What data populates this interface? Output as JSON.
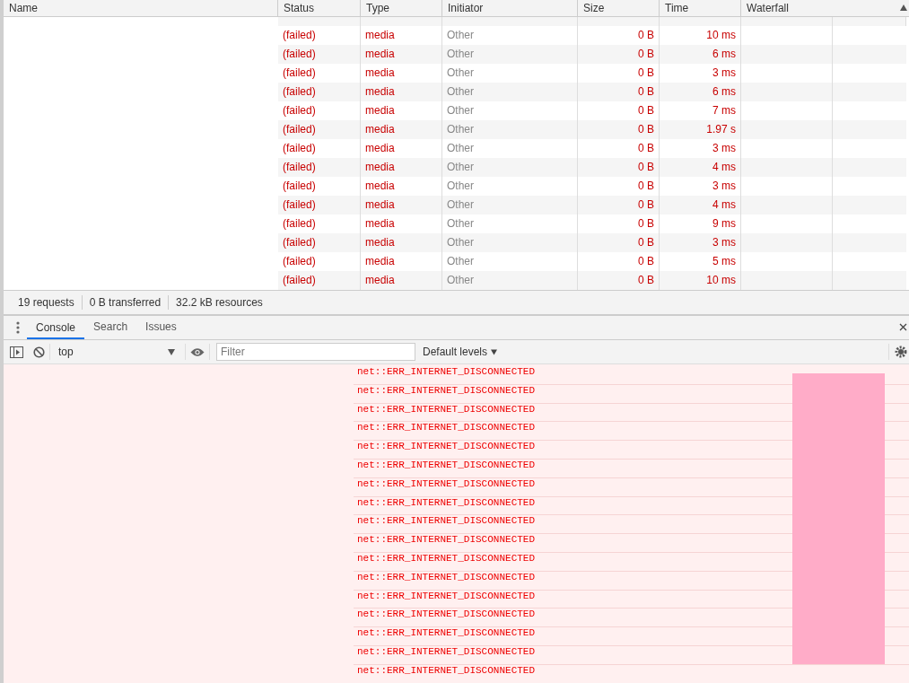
{
  "network": {
    "columns": [
      "Name",
      "Status",
      "Type",
      "Initiator",
      "Size",
      "Time",
      "Waterfall"
    ],
    "rows": [
      {
        "status": "(failed)",
        "type": "media",
        "initiator": "Other",
        "size": "0 B",
        "time": "10 ms"
      },
      {
        "status": "(failed)",
        "type": "media",
        "initiator": "Other",
        "size": "0 B",
        "time": "6 ms"
      },
      {
        "status": "(failed)",
        "type": "media",
        "initiator": "Other",
        "size": "0 B",
        "time": "3 ms"
      },
      {
        "status": "(failed)",
        "type": "media",
        "initiator": "Other",
        "size": "0 B",
        "time": "6 ms"
      },
      {
        "status": "(failed)",
        "type": "media",
        "initiator": "Other",
        "size": "0 B",
        "time": "7 ms"
      },
      {
        "status": "(failed)",
        "type": "media",
        "initiator": "Other",
        "size": "0 B",
        "time": "1.97 s"
      },
      {
        "status": "(failed)",
        "type": "media",
        "initiator": "Other",
        "size": "0 B",
        "time": "3 ms"
      },
      {
        "status": "(failed)",
        "type": "media",
        "initiator": "Other",
        "size": "0 B",
        "time": "4 ms"
      },
      {
        "status": "(failed)",
        "type": "media",
        "initiator": "Other",
        "size": "0 B",
        "time": "3 ms"
      },
      {
        "status": "(failed)",
        "type": "media",
        "initiator": "Other",
        "size": "0 B",
        "time": "4 ms"
      },
      {
        "status": "(failed)",
        "type": "media",
        "initiator": "Other",
        "size": "0 B",
        "time": "9 ms"
      },
      {
        "status": "(failed)",
        "type": "media",
        "initiator": "Other",
        "size": "0 B",
        "time": "3 ms"
      },
      {
        "status": "(failed)",
        "type": "media",
        "initiator": "Other",
        "size": "0 B",
        "time": "5 ms"
      },
      {
        "status": "(failed)",
        "type": "media",
        "initiator": "Other",
        "size": "0 B",
        "time": "10 ms"
      }
    ],
    "summary": [
      "19 requests",
      "0 B transferred",
      "32.2 kB resources"
    ]
  },
  "drawer": {
    "tabs": [
      {
        "label": "Console",
        "selected": true
      },
      {
        "label": "Search",
        "selected": false
      },
      {
        "label": "Issues",
        "selected": false
      }
    ],
    "context": "top",
    "filter": {
      "placeholder": "Filter"
    },
    "levels": "Default levels",
    "messages": [
      "net::ERR_INTERNET_DISCONNECTED",
      "net::ERR_INTERNET_DISCONNECTED",
      "net::ERR_INTERNET_DISCONNECTED",
      "net::ERR_INTERNET_DISCONNECTED",
      "net::ERR_INTERNET_DISCONNECTED",
      "net::ERR_INTERNET_DISCONNECTED",
      "net::ERR_INTERNET_DISCONNECTED",
      "net::ERR_INTERNET_DISCONNECTED",
      "net::ERR_INTERNET_DISCONNECTED",
      "net::ERR_INTERNET_DISCONNECTED",
      "net::ERR_INTERNET_DISCONNECTED",
      "net::ERR_INTERNET_DISCONNECTED",
      "net::ERR_INTERNET_DISCONNECTED",
      "net::ERR_INTERNET_DISCONNECTED",
      "net::ERR_INTERNET_DISCONNECTED",
      "net::ERR_INTERNET_DISCONNECTED",
      "net::ERR_INTERNET_DISCONNECTED"
    ]
  }
}
